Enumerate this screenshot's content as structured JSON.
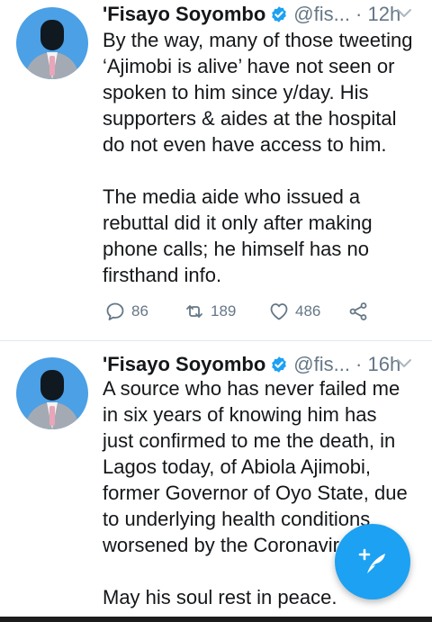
{
  "tweets": [
    {
      "author_name": "'Fisayo Soyombo",
      "handle": "@fis...",
      "separator": " · ",
      "time": "12h",
      "paragraphs": [
        "By the way, many of those tweeting ‘Ajimobi is alive’ have not seen or spoken to him since y/day. His supporters & aides at the hospital do not even have access to him.",
        "The media aide who issued a rebuttal did it only after making phone calls; he himself has no firsthand info."
      ],
      "replies": "86",
      "retweets": "189",
      "likes": "486"
    },
    {
      "author_name": "'Fisayo Soyombo",
      "handle": "@fis...",
      "separator": " · ",
      "time": "16h",
      "paragraphs": [
        "A source who has never failed me in six years of knowing him has just confirmed to me the death, in Lagos today, of Abiola Ajimobi, former Governor of Oyo State, due to underlying health conditions worsened by the Coronavir",
        "May his soul rest in peace."
      ]
    }
  ],
  "colors": {
    "accent": "#1da1f2",
    "secondary_text": "#657786",
    "divider": "#e1e8ed"
  },
  "icons": {
    "verified": "verified-badge-icon",
    "caret": "chevron-down-icon",
    "reply": "reply-icon",
    "retweet": "retweet-icon",
    "like": "heart-icon",
    "share": "share-icon",
    "compose": "compose-tweet-icon"
  }
}
